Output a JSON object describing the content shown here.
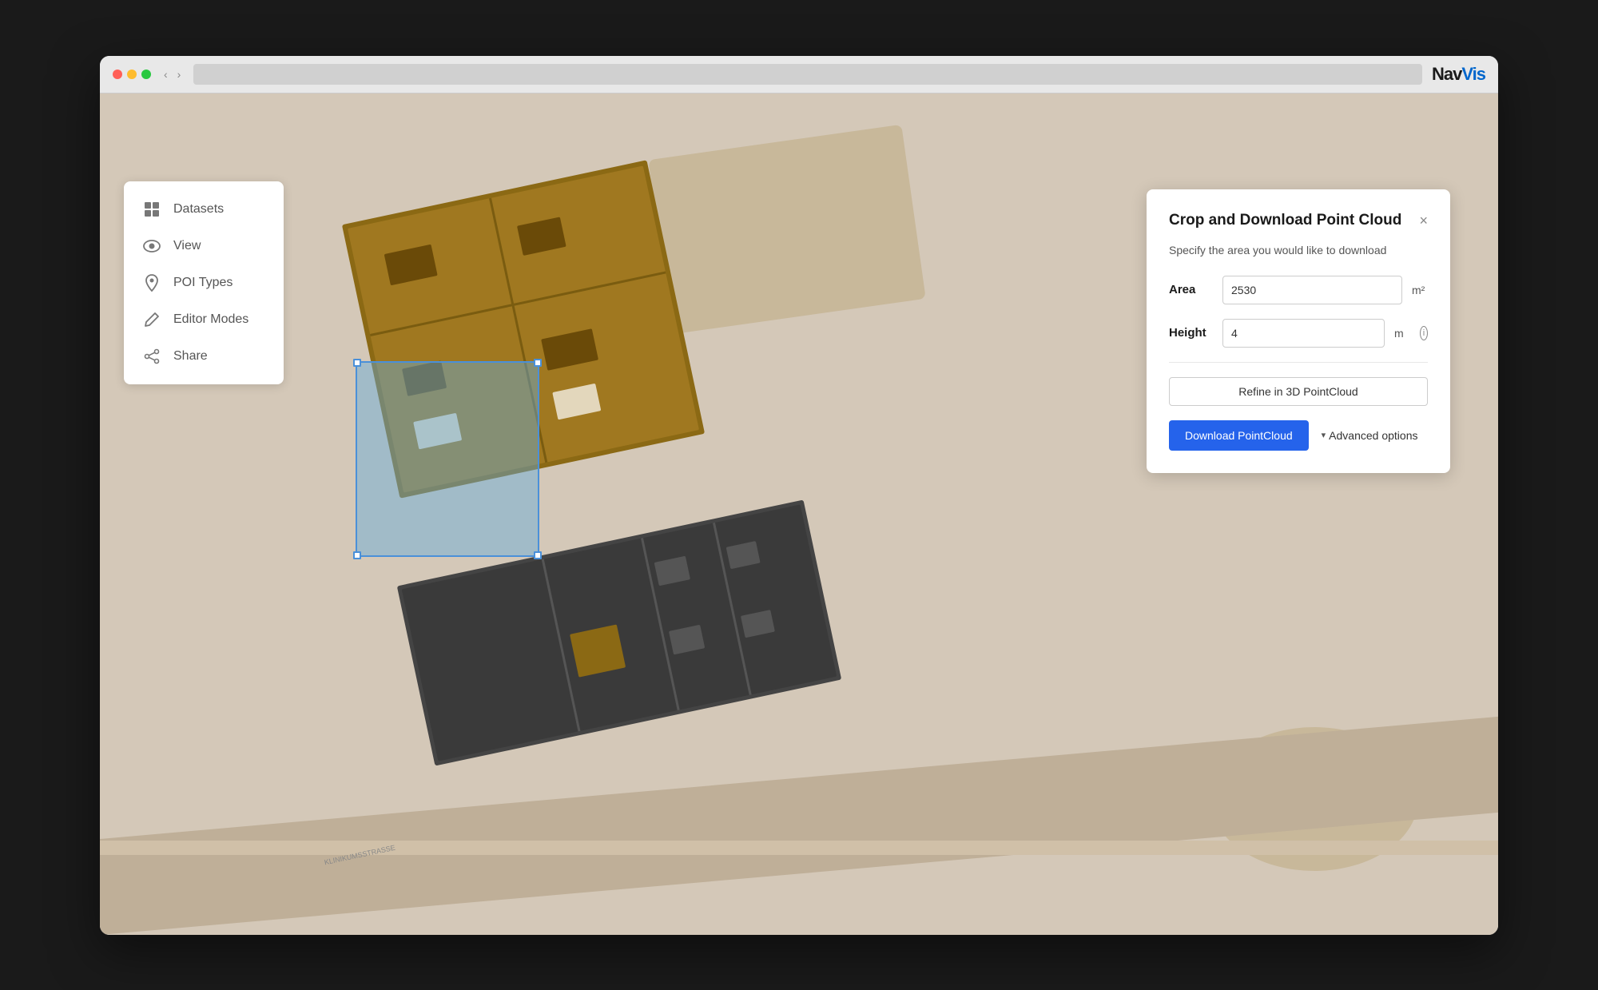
{
  "browser": {
    "logo_nav": "Nav",
    "logo_vis": "Vis"
  },
  "sidebar": {
    "items": [
      {
        "id": "datasets",
        "label": "Datasets",
        "icon": "grid"
      },
      {
        "id": "view",
        "label": "View",
        "icon": "eye"
      },
      {
        "id": "poi-types",
        "label": "POI Types",
        "icon": "pin"
      },
      {
        "id": "editor-modes",
        "label": "Editor Modes",
        "icon": "pencil"
      },
      {
        "id": "share",
        "label": "Share",
        "icon": "share"
      }
    ]
  },
  "crop_panel": {
    "title": "Crop and Download Point Cloud",
    "close_label": "×",
    "description": "Specify the area you would like to download",
    "area_label": "Area",
    "area_value": "2530",
    "area_unit": "m²",
    "height_label": "Height",
    "height_value": "4",
    "height_unit": "m",
    "refine_button_label": "Refine in 3D PointCloud",
    "download_button_label": "Download PointCloud",
    "advanced_options_label": "Advanced options",
    "advanced_options_arrow": "▾"
  },
  "map": {
    "street_label": "KLINIKUMSSTRASSE"
  }
}
